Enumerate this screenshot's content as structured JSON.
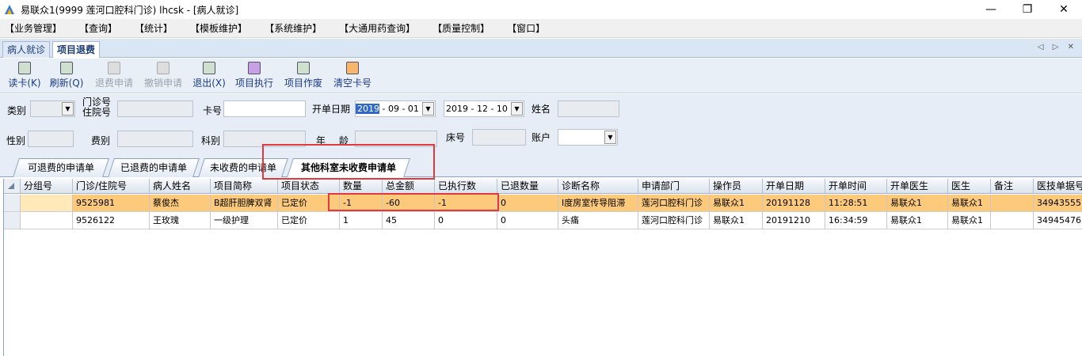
{
  "window": {
    "title": "易联众1(9999 莲河口腔科门诊) lhcsk - [病人就诊]",
    "minimize_glyph": "—",
    "restore_glyph": "❐",
    "close_glyph": "✕"
  },
  "menu": [
    "【业务管理】",
    "【查询】",
    "【统计】",
    "【模板维护】",
    "【系统维护】",
    "【大通用药查询】",
    "【质量控制】",
    "【窗口】"
  ],
  "doc_tabs": [
    "病人就诊",
    "项目退费"
  ],
  "doc_nav": "◁ ▷ ✕",
  "toolbar": [
    {
      "label": "读卡(K)",
      "icon": "card-reader-icon",
      "enabled": true
    },
    {
      "label": "刷新(Q)",
      "icon": "refresh-icon",
      "enabled": true
    },
    {
      "label": "退费申请",
      "icon": "refund-request-icon",
      "enabled": false
    },
    {
      "label": "撤销申请",
      "icon": "cancel-request-icon",
      "enabled": false
    },
    {
      "label": "退出(X)",
      "icon": "exit-icon",
      "enabled": true
    },
    {
      "label": "项目执行",
      "icon": "execute-icon",
      "enabled": true
    },
    {
      "label": "项目作废",
      "icon": "trash-icon",
      "enabled": true
    },
    {
      "label": "清空卡号",
      "icon": "eraser-icon",
      "enabled": true
    }
  ],
  "form": {
    "category_label": "类别",
    "clinic_no_label": "门诊号",
    "inpatient_no_label": "住院号",
    "card_label": "卡号",
    "date_label": "开单日期",
    "date_from": {
      "year": "2019",
      "rest": " - 09 - 01"
    },
    "date_to": "2019 - 12 - 10",
    "name_label": "姓名",
    "gender_label": "性别",
    "fee_type_label": "费别",
    "dept_label": "科别",
    "age_label_1": "年",
    "age_label_2": "龄",
    "bed_label": "床号",
    "account_label": "账户",
    "combo_arrow": "▼"
  },
  "sub_tabs": [
    "可退费的申请单",
    "已退费的申请单",
    "未收费的申请单",
    "其他科室未收费申请单"
  ],
  "grid": {
    "columns": [
      "分组号",
      "门诊/住院号",
      "病人姓名",
      "项目简称",
      "项目状态",
      "数量",
      "总金额",
      "已执行数",
      "已退数量",
      "诊断名称",
      "申请部门",
      "操作员",
      "开单日期",
      "开单时间",
      "开单医生",
      "医生",
      "备注",
      "医技单据号"
    ],
    "rows": [
      [
        "",
        "9525981",
        "蔡俊杰",
        "B超肝胆脾双肾",
        "已定价",
        "-1",
        "-60",
        "-1",
        "0",
        "I度房室传导阻滞",
        "莲河口腔科门诊",
        "易联众1",
        "20191128",
        "11:28:51",
        "易联众1",
        "易联众1",
        "",
        "34943555"
      ],
      [
        "",
        "9526122",
        "王玫瑰",
        "一级护理",
        "已定价",
        "1",
        "45",
        "0",
        "0",
        "头痛",
        "莲河口腔科门诊",
        "易联众1",
        "20191210",
        "16:34:59",
        "易联众1",
        "易联众1",
        "",
        "34945476"
      ]
    ],
    "selected_row": 0
  }
}
